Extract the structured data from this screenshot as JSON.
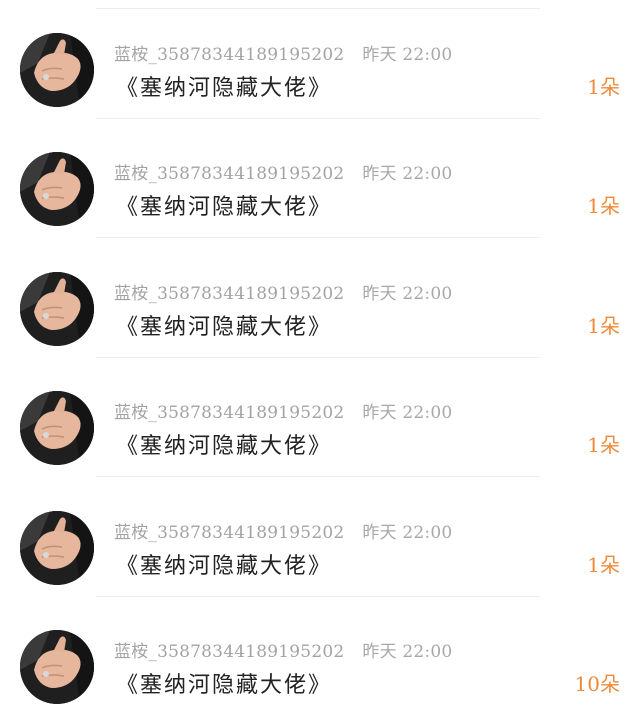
{
  "messages": [
    {
      "username": "蓝桉_3587834418​9195202",
      "time": "昨天 22:00",
      "text": "《塞纳河隐藏大佬》",
      "gift": "1朵"
    },
    {
      "username": "蓝桉_3587834418​9195202",
      "time": "昨天 22:00",
      "text": "《塞纳河隐藏大佬》",
      "gift": "1朵"
    },
    {
      "username": "蓝桉_3587834418​9195202",
      "time": "昨天 22:00",
      "text": "《塞纳河隐藏大佬》",
      "gift": "1朵"
    },
    {
      "username": "蓝桉_3587834418​9195202",
      "time": "昨天 22:00",
      "text": "《塞纳河隐藏大佬》",
      "gift": "1朵"
    },
    {
      "username": "蓝桉_3587834418​9195202",
      "time": "昨天 22:00",
      "text": "《塞纳河隐藏大佬》",
      "gift": "1朵"
    },
    {
      "username": "蓝桉_3587834418​9195202",
      "time": "昨天 22:00",
      "text": "《塞纳河隐藏大佬》",
      "gift": "10朵"
    }
  ],
  "colors": {
    "accent": "#ef8a3a",
    "meta_text": "#a3a3a3",
    "message_text": "#222222",
    "divider": "#ededed"
  },
  "icons": {
    "avatar": "user-avatar-hand-photo"
  }
}
